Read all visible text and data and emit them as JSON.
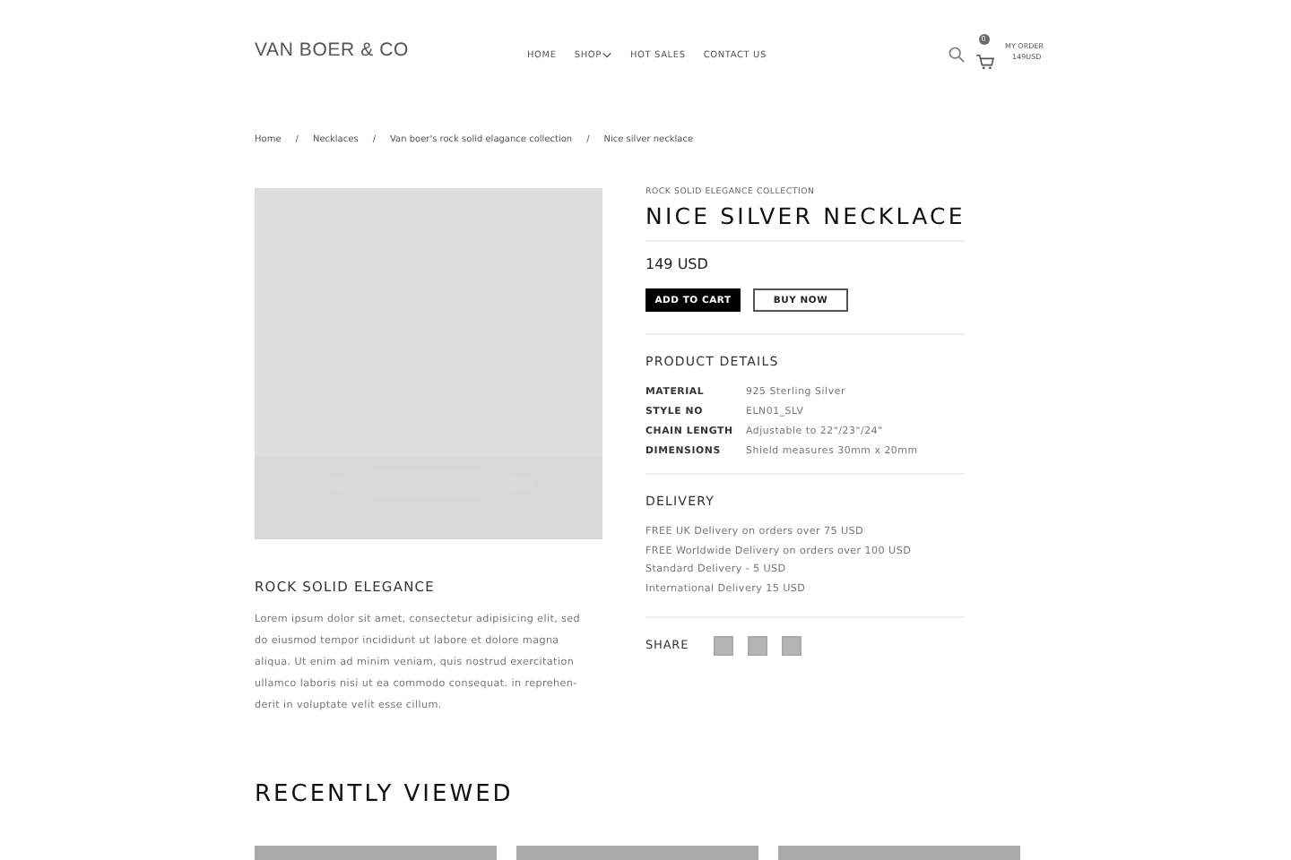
{
  "header": {
    "logo": "VAN BOER & CO",
    "nav": [
      {
        "label": "HOME",
        "dropdown": false
      },
      {
        "label": "SHOP",
        "dropdown": true
      },
      {
        "label": "HOT SALES",
        "dropdown": false
      },
      {
        "label": "CONTACT US",
        "dropdown": false
      }
    ],
    "cart_count": "0",
    "order_label": "MY ORDER",
    "order_total": "149USD"
  },
  "breadcrumb": [
    {
      "label": "Home"
    },
    {
      "separator": "/",
      "label": "Necklaces"
    },
    {
      "separator": "/",
      "label": "Van boer's rock solid elagance collection"
    },
    {
      "separator": "/",
      "label": "Nice silver necklace"
    }
  ],
  "product": {
    "image": {
      "kind": "picture"
    },
    "collection": "ROCK SOLID ELEGANCE COLLECTION",
    "title": "NICE SILVER NECKLACE",
    "price": "149 USD",
    "add_to_cart": "ADD TO CART",
    "buy_now": "BUY NOW",
    "details_heading": "PRODUCT DETAILS",
    "details": [
      {
        "label": "MATERIAL",
        "value": "925 Sterling Silver"
      },
      {
        "label": "STYLE NO",
        "value": "ELN01_SLV"
      },
      {
        "label": "CHAIN LENGTH",
        "value": "Adjustable to 22\"/23\"/24\""
      },
      {
        "label": "DIMENSIONS",
        "value": "Shield measures 30mm x 20mm"
      }
    ],
    "delivery_heading": "DELIVERY",
    "delivery": [
      "FREE UK Delivery on orders over 75 USD",
      "FREE Worldwide Delivery on orders over 100 USD",
      "Standard Delivery - 5 USD",
      "International Delivery 15 USD"
    ],
    "share_label": "SHARE",
    "description_heading": "ROCK SOLID ELEGANCE",
    "description_lines": [
      "Lorem ipsum dolor sit amet, consectetur adipisicing elit, sed",
      "do eiusmod tempor incididunt ut labore et dolore magna",
      "aliqua. Ut enim ad minim veniam, quis nostrud exercitation",
      "ullamco laboris nisi ut  ea commodo consequat.  in reprehen-",
      "derit in voluptate velit esse cillum."
    ]
  },
  "recently_viewed": {
    "heading": "RECENTLY VIEWED"
  }
}
